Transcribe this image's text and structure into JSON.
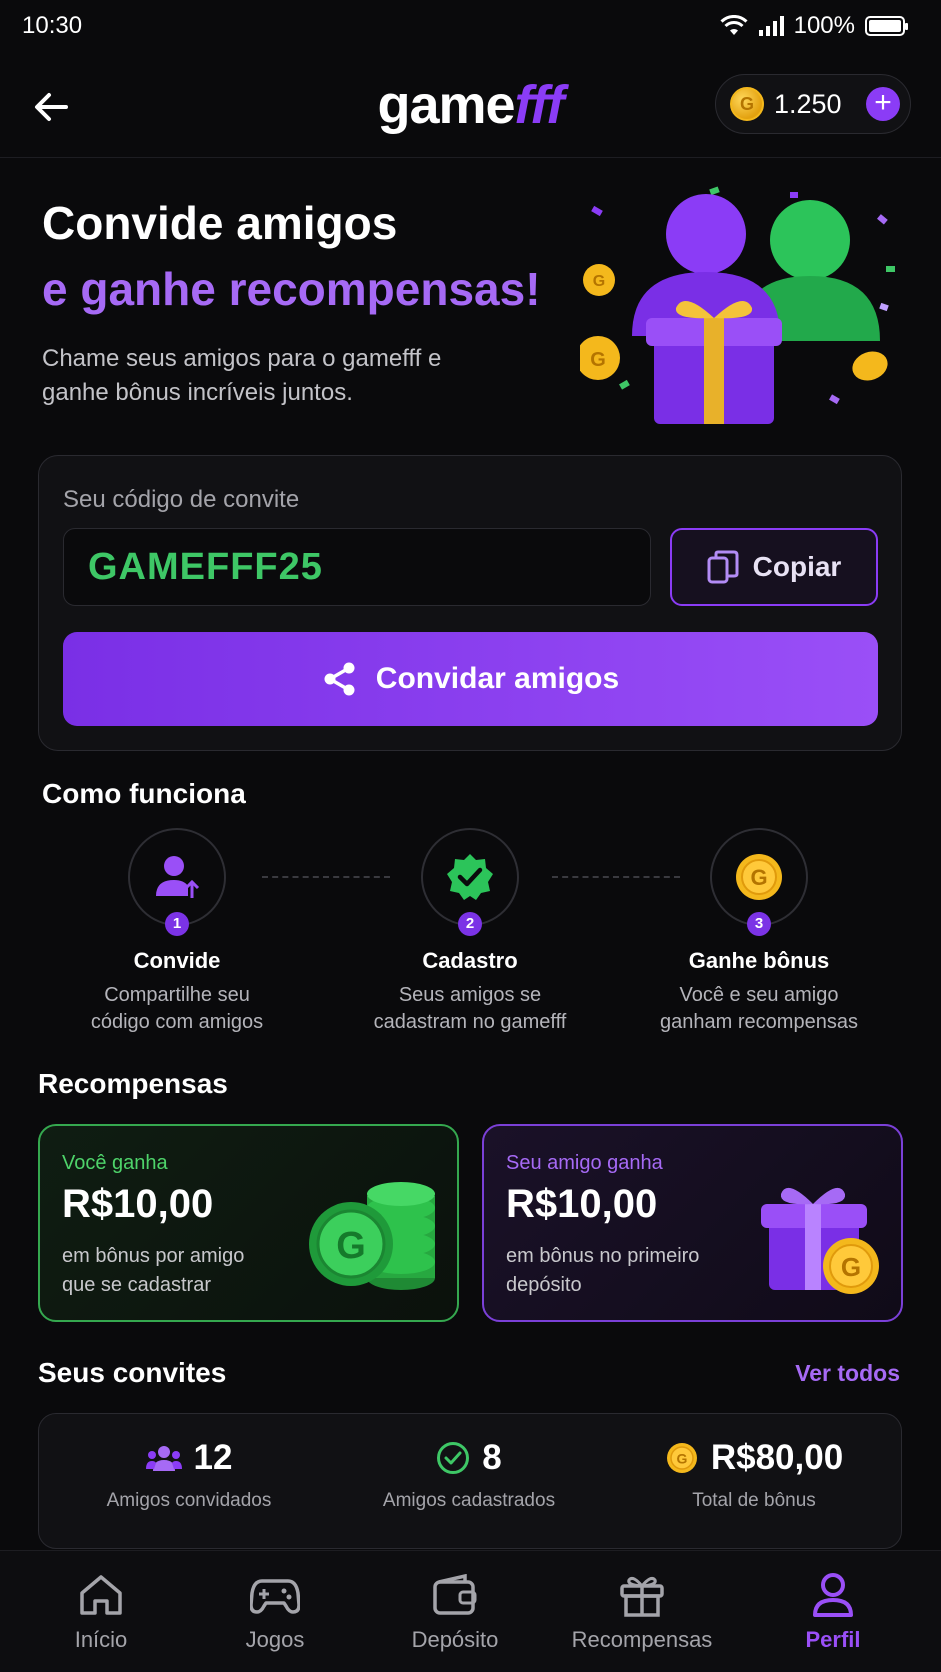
{
  "status_bar": {
    "time": "10:30",
    "battery": "100%"
  },
  "header": {
    "logo_part1": "game",
    "logo_part2": "fff",
    "balance": "1.250",
    "coin_letter": "G"
  },
  "hero": {
    "title_line1": "Convide amigos",
    "title_line2": "e ganhe recompensas!",
    "subtitle": "Chame seus amigos para o gamefff e ganhe bônus incríveis juntos."
  },
  "invite": {
    "code_label": "Seu código de convite",
    "code": "GAMEFFF25",
    "copy_label": "Copiar",
    "invite_label": "Convidar amigos"
  },
  "how_it_works": {
    "title": "Como funciona",
    "steps": [
      {
        "number": "1",
        "title": "Convide",
        "desc_line1": "Compartilhe seu",
        "desc_line2": "código com amigos"
      },
      {
        "number": "2",
        "title": "Cadastro",
        "desc_line1": "Seus amigos se",
        "desc_line2": "cadastram no gamefff"
      },
      {
        "number": "3",
        "title": "Ganhe bônus",
        "desc_line1": "Você e seu amigo",
        "desc_line2": "ganham recompensas"
      }
    ]
  },
  "rewards": {
    "title": "Recompensas",
    "you": {
      "label": "Você ganha",
      "value": "R$10,00",
      "desc": "em bônus por amigo que se cadastrar"
    },
    "friend": {
      "label": "Seu amigo ganha",
      "value": "R$10,00",
      "desc": "em bônus no primeiro depósito"
    }
  },
  "invites": {
    "title": "Seus convites",
    "see_all": "Ver todos",
    "stats": [
      {
        "value": "12",
        "caption": "Amigos convidados",
        "icon": "users-icon"
      },
      {
        "value": "8",
        "caption": "Amigos cadastrados",
        "icon": "check-circle-icon"
      },
      {
        "value": "R$80,00",
        "caption": "Total de bônus",
        "icon": "coin-icon"
      }
    ]
  },
  "tabbar": {
    "items": [
      {
        "label": "Início",
        "icon": "home-icon"
      },
      {
        "label": "Jogos",
        "icon": "gamepad-icon"
      },
      {
        "label": "Depósito",
        "icon": "wallet-icon"
      },
      {
        "label": "Recompensas",
        "icon": "gift-icon"
      },
      {
        "label": "Perfil",
        "icon": "user-icon",
        "active": true
      }
    ]
  },
  "colors": {
    "accent": "#8b3cf6",
    "green": "#3ec766",
    "background": "#0a0a0c",
    "gold": "#f4b81c"
  }
}
